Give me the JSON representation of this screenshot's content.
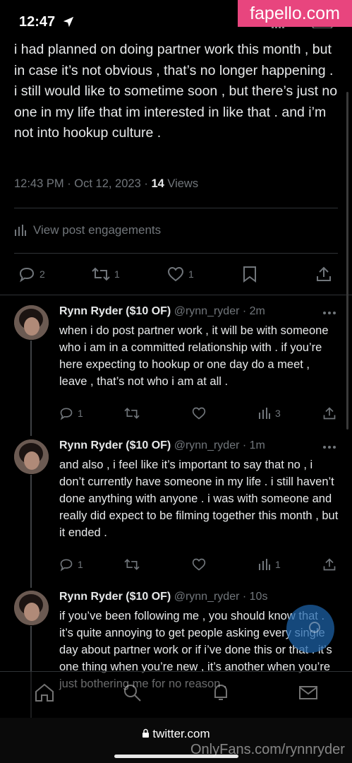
{
  "status_bar": {
    "time": "12:47"
  },
  "watermarks": {
    "top": "fapello.com",
    "bottom": "OnlyFans.com/rynnryder"
  },
  "tweet": {
    "text": "i had planned on doing partner work this month , but in case it’s not obvious , that’s no longer happening . i still would like to sometime soon , but there’s just no one in my life that im interested in like that . and i’m not into hookup culture .",
    "timestamp": "12:43 PM · Oct 12, 2023 · ",
    "views_count": "14",
    "views_label": " Views",
    "engagements_label": "View post engagements",
    "replies": "2",
    "reposts": "1",
    "likes": "1"
  },
  "replies": [
    {
      "name": "Rynn Ryder ($10 OF)",
      "handle": " @rynn_ryder · 2m",
      "text": "when i do post partner work , it will be with someone who i am in a committed relationship with . if you’re here expecting to hookup or one day do a meet , leave , that’s not who i am at all .",
      "replies": "1",
      "reposts": "",
      "likes": "",
      "views": "3"
    },
    {
      "name": "Rynn Ryder ($10 OF)",
      "handle": " @rynn_ryder · 1m",
      "text": "and also , i feel like it’s important to say that no , i don’t currently have someone in my life . i still haven’t done anything with anyone . i was with someone and really did expect to be filming together this month , but it ended .",
      "replies": "1",
      "reposts": "",
      "likes": "",
      "views": "1"
    },
    {
      "name": "Rynn Ryder ($10 OF)",
      "handle": " @rynn_ryder · 10s",
      "text": "if you’ve been following me , you should know that . it’s quite annoying to get people asking every single day about partner work or if i’ve done this or that . it’s one thing when you’re new , it’s another when you’re just bothering me for no reason ."
    }
  ],
  "browser": {
    "url": "twitter.com"
  },
  "colors": {
    "background": "#000000",
    "text": "#e7e9ea",
    "muted": "#71767b",
    "accent": "#1d9bf0",
    "watermark_pink": "#e8457e"
  }
}
